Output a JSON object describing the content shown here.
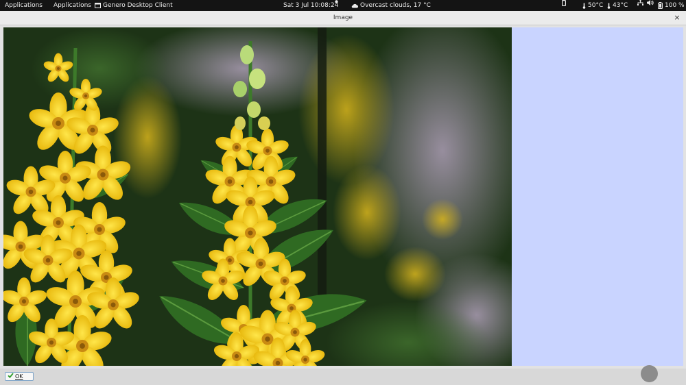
{
  "topbar": {
    "activities": "Applications",
    "apps_menu": "Applications",
    "app_name": "Genero Desktop Client",
    "datetime": "Sat 3 Jul  10:08:24",
    "weather": "Overcast clouds, 17 °C",
    "cpu_temp": "50°C",
    "gpu_temp": "43°C",
    "battery": "100 %"
  },
  "window": {
    "title": "Image",
    "close_symbol": "×"
  },
  "footer": {
    "ok_label": "OK"
  },
  "colors": {
    "side_panel": "#c9d4ff",
    "topbar": "#141414",
    "flower": "#f2d22a"
  },
  "icons": {
    "app": "window-icon",
    "weather": "cloud-icon",
    "phone": "phone-icon",
    "thermometer": "thermometer-icon",
    "volume": "volume-icon",
    "network": "network-icon",
    "battery": "battery-icon",
    "ok": "checkmark-icon"
  }
}
